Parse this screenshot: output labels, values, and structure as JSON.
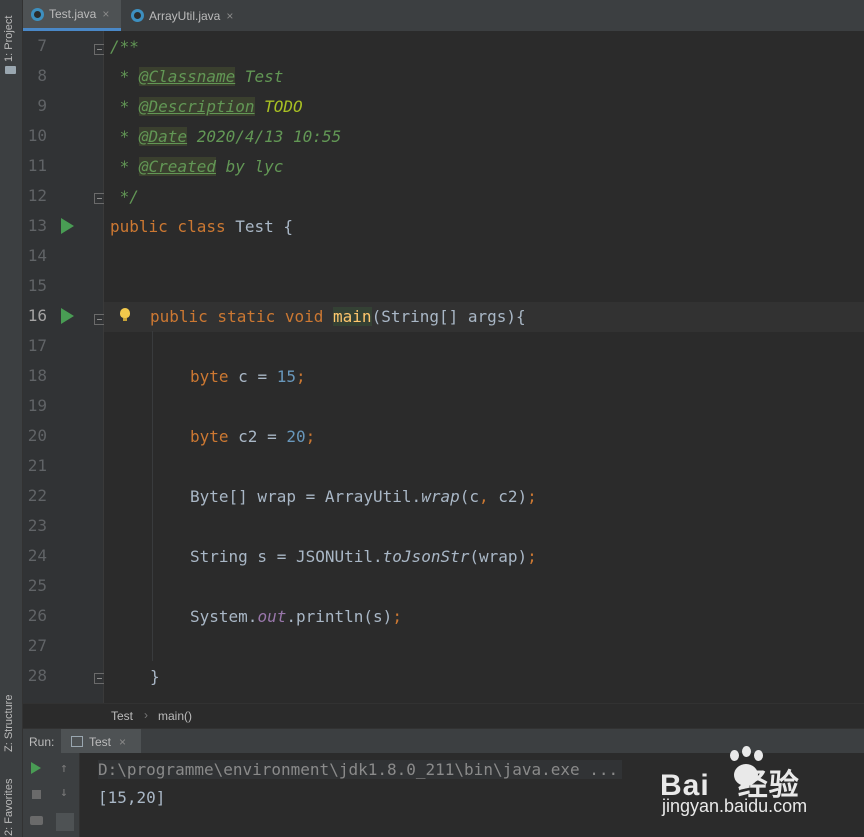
{
  "sidebar": {
    "project_label": "1: Project",
    "structure_label": "Z: Structure",
    "favorites_label": "2: Favorites"
  },
  "tabs": [
    {
      "label": "Test.java",
      "active": true
    },
    {
      "label": "ArrayUtil.java",
      "active": false
    }
  ],
  "tab_close_glyph": "×",
  "line_numbers": [
    "7",
    "8",
    "9",
    "10",
    "11",
    "12",
    "13",
    "14",
    "15",
    "16",
    "17",
    "18",
    "19",
    "20",
    "21",
    "22",
    "23",
    "24",
    "25",
    "26",
    "27",
    "28"
  ],
  "code": {
    "l7": "/**",
    "l8_star": " * ",
    "l8_tag": "@Classname",
    "l8_rest": " Test",
    "l9_star": " * ",
    "l9_tag": "@Description",
    "l9_rest": " TODO",
    "l10_star": " * ",
    "l10_tag": "@Date",
    "l10_rest": " 2020/4/13 10:55",
    "l11_star": " * ",
    "l11_tag": "@Created",
    "l11_rest": " by lyc",
    "l12": " */",
    "l13_kw": "public class ",
    "l13_rest": "Test {",
    "l16_kw": "public static void ",
    "l16_fn": "main",
    "l16_rest": "(String[] args){",
    "l18_kw": "byte ",
    "l18_a": "c = ",
    "l18_num": "15",
    "l18_semi": ";",
    "l20_kw": "byte ",
    "l20_a": "c2 = ",
    "l20_num": "20",
    "l20_semi": ";",
    "l22_a": "Byte[] wrap = ArrayUtil.",
    "l22_st": "wrap",
    "l22_b": "(c",
    "l22_comma": ",",
    "l22_c": " c2)",
    "l22_semi": ";",
    "l24_a": "String s = JSONUtil.",
    "l24_st": "toJsonStr",
    "l24_b": "(wrap)",
    "l24_semi": ";",
    "l26_a": "System.",
    "l26_fld": "out",
    "l26_b": ".println(s)",
    "l26_semi": ";",
    "l28": "}"
  },
  "breadcrumb": {
    "class": "Test",
    "sep": "›",
    "method": "main()"
  },
  "run": {
    "label": "Run:",
    "tab": "Test",
    "console": [
      "D:\\programme\\environment\\jdk1.8.0_211\\bin\\java.exe ...",
      "[15,20]"
    ]
  },
  "watermark": {
    "logo": "Bai   经验",
    "url": "jingyan.baidu.com"
  },
  "colors": {
    "keyword": "#cc7832",
    "comment": "#629755",
    "number": "#6897bb",
    "method": "#ffc66d",
    "run_green": "#499c54"
  }
}
